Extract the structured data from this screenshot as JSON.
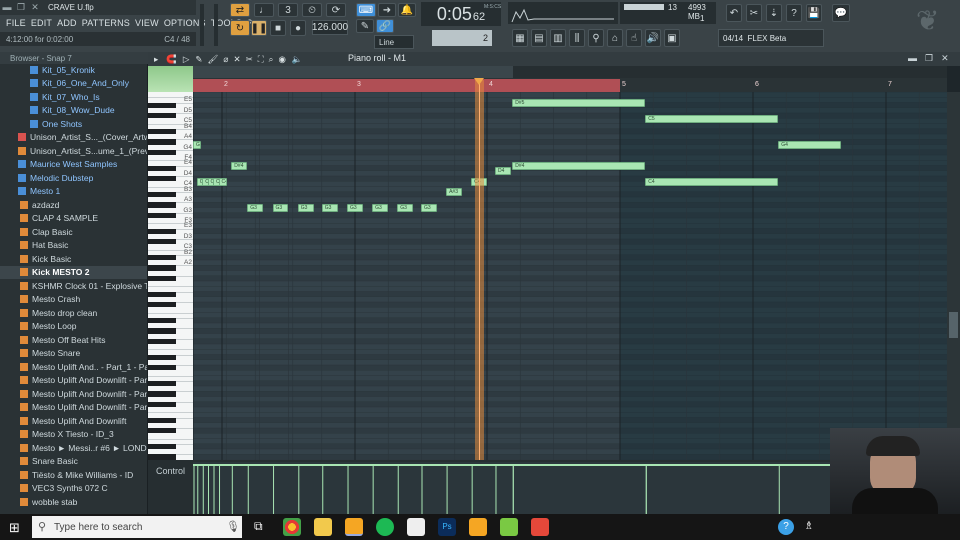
{
  "window": {
    "filename": "CRAVE U.flp"
  },
  "menu": [
    "FILE",
    "EDIT",
    "ADD",
    "PATTERNS",
    "VIEW",
    "OPTIONS",
    "TOOLS",
    "?"
  ],
  "hint": {
    "left": "4:12:00 for 0:02:00",
    "right": "C4 / 48"
  },
  "transport": {
    "pat_label": "PAT",
    "song_label": "SONG",
    "tempo": "126.000",
    "time_main": "0:05",
    "time_small": "62",
    "time_unit": "M:S:CS"
  },
  "snap": {
    "mode": "Line",
    "step_value": "2"
  },
  "cpu": {
    "value1": "13",
    "memory": "4993 MB",
    "value2": "1"
  },
  "plugin": {
    "slot": "04/14",
    "name": "FLEX Beta"
  },
  "browser": {
    "header": "Browser - Snap 7",
    "items": [
      {
        "label": "Kit_05_Kronik",
        "type": "folder-blue"
      },
      {
        "label": "Kit_06_One_And_Only",
        "type": "folder-blue"
      },
      {
        "label": "Kit_07_Who_Is",
        "type": "folder-blue"
      },
      {
        "label": "Kit_08_Wow_Dude",
        "type": "folder-blue"
      },
      {
        "label": "One Shots",
        "type": "folder-blue"
      },
      {
        "label": "Unison_Artist_S..._(Cover_Artwork)",
        "type": "image"
      },
      {
        "label": "Unison_Artist_S...ume_1_(Preview)",
        "type": "audio"
      },
      {
        "label": "Maurice West Samples",
        "type": "folder-blue"
      },
      {
        "label": "Melodic Dubstep",
        "type": "folder-blue"
      },
      {
        "label": "Mesto 1",
        "type": "folder-blue"
      },
      {
        "label": "azdazd",
        "type": "audio"
      },
      {
        "label": "CLAP 4 SAMPLE",
        "type": "audio"
      },
      {
        "label": "Clap Basic",
        "type": "audio"
      },
      {
        "label": "Hat Basic",
        "type": "audio"
      },
      {
        "label": "Kick Basic",
        "type": "audio"
      },
      {
        "label": "Kick MESTO 2",
        "type": "selected"
      },
      {
        "label": "KSHMR Clock 01 - Explosive Timer",
        "type": "audio"
      },
      {
        "label": "Mesto Crash",
        "type": "audio"
      },
      {
        "label": "Mesto drop clean",
        "type": "audio"
      },
      {
        "label": "Mesto Loop",
        "type": "audio"
      },
      {
        "label": "Mesto Off Beat Hits",
        "type": "audio"
      },
      {
        "label": "Mesto Snare",
        "type": "audio"
      },
      {
        "label": "Mesto Uplift And.. - Part_1 - Part_1",
        "type": "audio"
      },
      {
        "label": "Mesto Uplift And Downlift - Part_1",
        "type": "audio"
      },
      {
        "label": "Mesto Uplift And Downlift - Part_2",
        "type": "audio"
      },
      {
        "label": "Mesto Uplift And Downlift - Part_3",
        "type": "audio"
      },
      {
        "label": "Mesto Uplift And Downlift",
        "type": "audio"
      },
      {
        "label": "Mesto X Tiesto - ID_3",
        "type": "audio"
      },
      {
        "label": "Mesto ► Messi..r #6 ► LONDON",
        "type": "audio"
      },
      {
        "label": "Snare Basic",
        "type": "audio"
      },
      {
        "label": "Tiësto & Mike Williams - ID",
        "type": "audio"
      },
      {
        "label": "VEC3 Synths 072 C",
        "type": "audio"
      },
      {
        "label": "wobble stab",
        "type": "audio"
      }
    ]
  },
  "pianoroll": {
    "title": "Piano roll - M1",
    "bar_numbers": [
      "2",
      "3",
      "4",
      "5",
      "6",
      "7"
    ],
    "key_labels": [
      "E5",
      "D5",
      "C5",
      "B4",
      "A4",
      "G4",
      "F4",
      "E4",
      "D4",
      "C4",
      "B3",
      "A3",
      "G3",
      "F3",
      "E3",
      "D3",
      "C3",
      "B2",
      "A2"
    ],
    "control_label": "Control",
    "notes": [
      {
        "pitch": "G4",
        "start": 1.0,
        "len": 0.12
      },
      {
        "pitch": "C4",
        "start": 1.13,
        "len": 0.12
      },
      {
        "pitch": "C4",
        "start": 1.32,
        "len": 0.12
      },
      {
        "pitch": "C4",
        "start": 1.5,
        "len": 0.12
      },
      {
        "pitch": "C4",
        "start": 1.69,
        "len": 0.12
      },
      {
        "pitch": "C4",
        "start": 1.88,
        "len": 0.12
      },
      {
        "pitch": "D#4",
        "start": 2.07,
        "len": 0.12
      },
      {
        "pitch": "G3",
        "start": 2.19,
        "len": 0.12
      },
      {
        "pitch": "G3",
        "start": 2.38,
        "len": 0.12
      },
      {
        "pitch": "G3",
        "start": 2.57,
        "len": 0.12
      },
      {
        "pitch": "G3",
        "start": 2.75,
        "len": 0.12
      },
      {
        "pitch": "G3",
        "start": 2.94,
        "len": 0.12
      },
      {
        "pitch": "G3",
        "start": 3.13,
        "len": 0.12
      },
      {
        "pitch": "G3",
        "start": 3.32,
        "len": 0.12
      },
      {
        "pitch": "G3",
        "start": 3.5,
        "len": 0.12
      },
      {
        "pitch": "A#3",
        "start": 3.69,
        "len": 0.12
      },
      {
        "pitch": "C4",
        "start": 3.88,
        "len": 0.12
      },
      {
        "pitch": "D4",
        "start": 4.06,
        "len": 0.12
      },
      {
        "pitch": "D#5",
        "start": 4.19,
        "len": 1.0
      },
      {
        "pitch": "D#4",
        "start": 4.19,
        "len": 1.0
      },
      {
        "pitch": "C5",
        "start": 5.19,
        "len": 1.0
      },
      {
        "pitch": "C4",
        "start": 5.19,
        "len": 1.0
      },
      {
        "pitch": "G4",
        "start": 6.19,
        "len": 0.47
      }
    ],
    "note_labels": {
      "G4": "G4",
      "C4": "C4",
      "D#4": "D#4",
      "G3": "G3",
      "A#3": "A#3",
      "D4": "D4",
      "D#5": "D#5",
      "C5": "C5"
    },
    "playhead_bar": 3.94
  },
  "taskbar": {
    "search_placeholder": "Type here to search"
  },
  "colors": {
    "note": "#a9e6b3",
    "ruler": "#b04f55",
    "playhead": "#e38b3c",
    "grid": "#34424a"
  }
}
